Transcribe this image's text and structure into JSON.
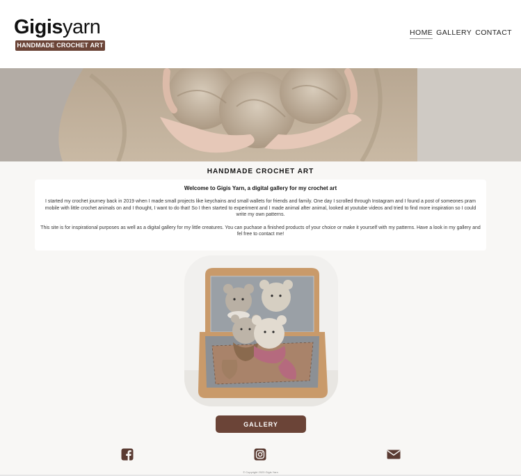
{
  "header": {
    "logo_bold": "Gigis",
    "logo_light": "yarn",
    "logo_tagline": "HANDMADE CROCHET ART",
    "nav": [
      {
        "label": "HOME",
        "active": true
      },
      {
        "label": "GALLERY",
        "active": false
      },
      {
        "label": "CONTACT",
        "active": false
      }
    ]
  },
  "main": {
    "heading": "HANDMADE CROCHET ART",
    "intro_title": "Welcome to Gigis Yarn, a digital gallery for my crochet art",
    "intro_paragraph_1": "I started my crochet journey back in 2019 when I made small projects like keychains and small wallets for friends and family. One day I scrolled through Instagram and I found a post of someones pram mobile with little crochet animals on and I thought, I want to do that! So I then started to experiment and I made animal after animal, looked at youtube videos and tried to find more inspiration so I could write my own patterns.",
    "intro_paragraph_2": "This site is for inspirational purposes as well as a digital gallery for my little creatures. You can puchase a finished products of your choice or make it yourself with my patterns. Have a look in my gallery and fel free to contact me!",
    "gallery_button": "GALLERY"
  },
  "footer": {
    "social": [
      {
        "name": "facebook-icon"
      },
      {
        "name": "instagram-icon"
      },
      {
        "name": "email-icon"
      }
    ],
    "copyright": "© Copyright 2023 Gigis Yarn"
  },
  "colors": {
    "brand": "#6b4437",
    "icon": "#5a3b32",
    "background": "#f8f7f5"
  }
}
